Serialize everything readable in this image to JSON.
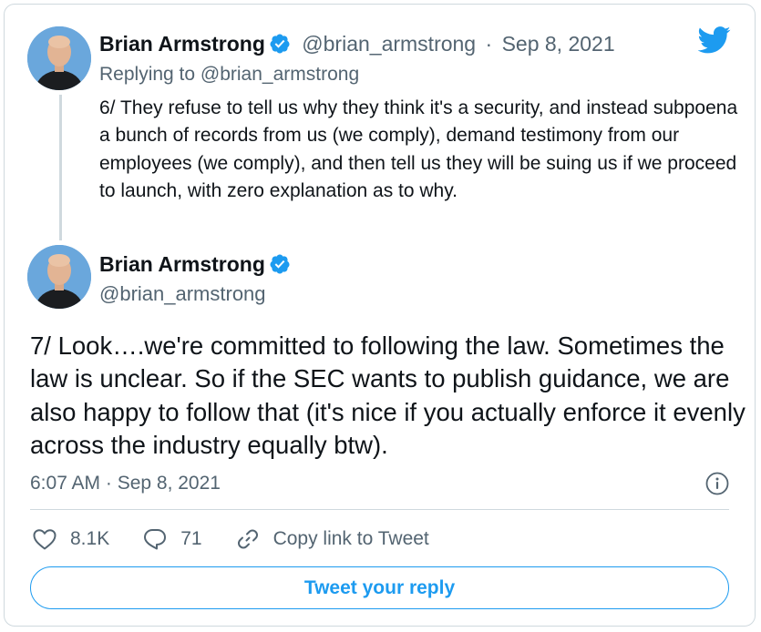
{
  "parent_tweet": {
    "author_name": "Brian Armstrong",
    "author_handle": "@brian_armstrong",
    "separator": "·",
    "date": "Sep 8, 2021",
    "replying_prefix": "Replying to",
    "replying_handle": "@brian_armstrong",
    "text": "6/ They refuse to tell us why they think it's a security, and instead subpoena a bunch of records from us (we comply), demand testimony from our employees (we comply), and then tell us they will be suing us if we proceed to launch, with zero explanation as to why."
  },
  "main_tweet": {
    "author_name": "Brian Armstrong",
    "author_handle": "@brian_armstrong",
    "text": "7/ Look….we're committed to following the law. Sometimes the law is unclear. So if the SEC wants to publish guidance, we are also happy to follow that (it's nice if you actually enforce it evenly across the industry equally btw).",
    "timestamp": "6:07 AM · Sep 8, 2021"
  },
  "actions": {
    "likes": "8.1K",
    "replies": "71",
    "copy_link_label": "Copy link to Tweet"
  },
  "reply_button_label": "Tweet your reply",
  "colors": {
    "brand_blue": "#1d9bf0",
    "text_primary": "#0f1419",
    "text_secondary": "#536471",
    "border": "#cfd9de",
    "avatar_background": "#6aa7dc"
  },
  "icons": {
    "logo": "twitter-bird-icon",
    "verified": "verified-badge-icon",
    "info": "info-icon",
    "like": "heart-icon",
    "reply": "speech-bubble-icon",
    "copy_link": "link-icon"
  }
}
